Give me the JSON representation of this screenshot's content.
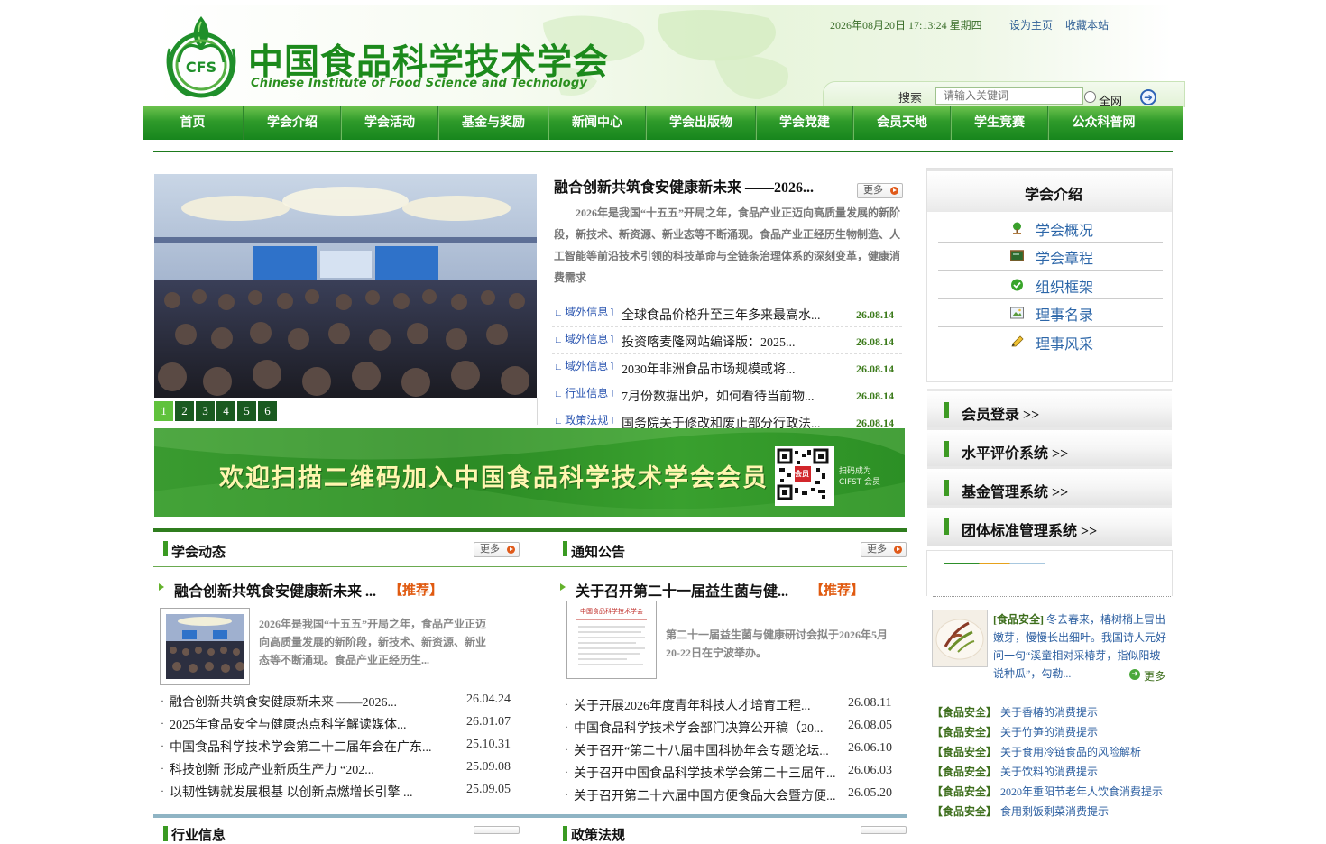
{
  "header": {
    "site_name": "中国食品科学技术学会",
    "site_name_en": "Chinese Institute of Food Science and Technology",
    "datetime": "2026年08月20日 17:13:24 星期四",
    "set_home": "设为主页",
    "bookmark": "收藏本站",
    "search_label": "搜索",
    "search_placeholder": "请输入关键词",
    "search_scope": "全网"
  },
  "nav": [
    "首页",
    "学会介绍",
    "学会活动",
    "基金与奖励",
    "新闻中心",
    "学会出版物",
    "学会党建",
    "会员天地",
    "学生竞赛",
    "公众科普网"
  ],
  "slideshow": {
    "pages": [
      "1",
      "2",
      "3",
      "4",
      "5",
      "6"
    ],
    "active": 1
  },
  "headline": {
    "title": "融合创新共筑食安健康新未来 ——2026...",
    "more": "更多",
    "summary": "2026年是我国“十五五”开局之年，食品产业正迈向高质量发展的新阶段，新技术、新资源、新业态等不断涌现。食品产业正经历生物制造、人工智能等前沿技术引领的科技革命与全链条治理体系的深刻变革，健康消费需求"
  },
  "news": [
    {
      "tag": "域外信息",
      "title": "全球食品价格升至三年多来最高水...",
      "date": "26.08.14"
    },
    {
      "tag": "域外信息",
      "title": "投资喀麦隆网站编译版：2025...",
      "date": "26.08.14"
    },
    {
      "tag": "域外信息",
      "title": "2030年非洲食品市场规模或将...",
      "date": "26.08.14"
    },
    {
      "tag": "行业信息",
      "title": "7月份数据出炉，如何看待当前物...",
      "date": "26.08.14"
    },
    {
      "tag": "政策法规",
      "title": "国务院关于修改和废止部分行政法...",
      "date": "26.08.14"
    }
  ],
  "banner": {
    "text": "欢迎扫描二维码加入中国食品科学技术学会会员",
    "qr_badge": "会员",
    "qr_caption": "扫码成为 CIFST 会员"
  },
  "society_news": {
    "title": "学会动态",
    "more": "更多",
    "rec_title": "融合创新共筑食安健康新未来 ...",
    "rec_tag": "【推荐】",
    "rec_summary": "2026年是我国“十五五”开局之年，食品产业正迈向高质量发展的新阶段，新技术、新资源、新业态等不断涌现。食品产业正经历生...",
    "items": [
      {
        "title": "融合创新共筑食安健康新未来 ——2026...",
        "date": "26.04.24"
      },
      {
        "title": "2025年食品安全与健康热点科学解读媒体...",
        "date": "26.01.07"
      },
      {
        "title": "中国食品科学技术学会第二十二届年会在广东...",
        "date": "25.10.31"
      },
      {
        "title": "科技创新 形成产业新质生产力 “202...",
        "date": "25.09.08"
      },
      {
        "title": "以韧性铸就发展根基 以创新点燃增长引擎 ...",
        "date": "25.09.05"
      }
    ]
  },
  "notices": {
    "title": "通知公告",
    "more": "更多",
    "rec_title": "关于召开第二十一届益生菌与健...",
    "rec_tag": "【推荐】",
    "rec_summary": "第二十一届益生菌与健康研讨会拟于2026年5月20-22日在宁波举办。",
    "doc_header": "中国食品科学技术学会",
    "items": [
      {
        "title": "关于开展2026年度青年科技人才培育工程...",
        "date": "26.08.11"
      },
      {
        "title": "中国食品科学技术学会部门决算公开稿（20...",
        "date": "26.08.05"
      },
      {
        "title": "关于召开“第二十八届中国科协年会专题论坛...",
        "date": "26.06.10"
      },
      {
        "title": "关于召开中国食品科学技术学会第二十三届年...",
        "date": "26.06.03"
      },
      {
        "title": "关于召开第二十六届中国方便食品大会暨方便...",
        "date": "26.05.20"
      }
    ]
  },
  "bottom_sections": [
    "行业信息",
    "政策法规"
  ],
  "sidebar": {
    "intro_title": "学会介绍",
    "intro_items": [
      {
        "label": "学会概况",
        "icon": "tree-icon"
      },
      {
        "label": "学会章程",
        "icon": "blackboard-icon"
      },
      {
        "label": "组织框架",
        "icon": "check-circle-icon"
      },
      {
        "label": "理事名录",
        "icon": "picture-icon"
      },
      {
        "label": "理事风采",
        "icon": "pencil-icon"
      }
    ],
    "links": [
      "会员登录 >>",
      "水平评价系统 >>",
      "基金管理系统 >>",
      "团体标准管理系统 >>"
    ],
    "safety_feature": {
      "tag": "[食品安全]",
      "text": "冬去春来，椿树梢上冒出嫩芽，慢慢长出细叶。我国诗人元好问一句“溪童相对采椿芽，指似阳坡说种瓜”，勾勒...",
      "more": "更多"
    },
    "safety_list": [
      {
        "tag": "【食品安全】",
        "title": "关于香椿的消费提示"
      },
      {
        "tag": "【食品安全】",
        "title": "关于竹笋的消费提示"
      },
      {
        "tag": "【食品安全】",
        "title": "关于食用冷链食品的风险解析"
      },
      {
        "tag": "【食品安全】",
        "title": "关于饮料的消费提示"
      },
      {
        "tag": "【食品安全】",
        "title": "2020年重阳节老年人饮食消费提示"
      },
      {
        "tag": "【食品安全】",
        "title": "食用剩饭剩菜消费提示"
      }
    ]
  },
  "colors": {
    "brand_green": "#1c8a1c",
    "nav_green": "#17861d",
    "link_blue": "#2c66a8",
    "recommend": "#e05a10"
  }
}
